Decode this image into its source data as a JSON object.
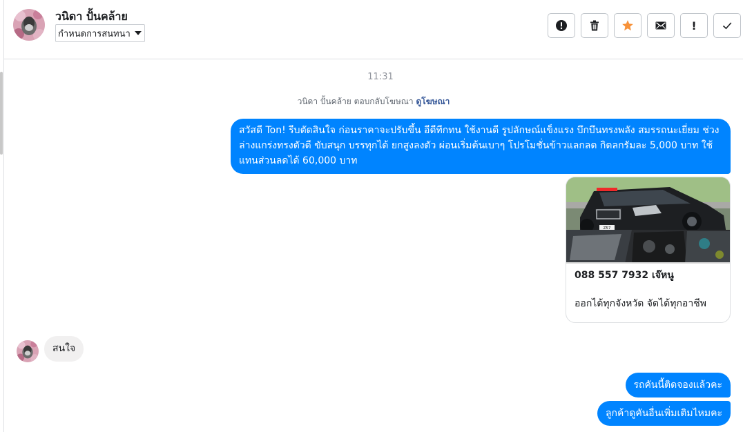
{
  "header": {
    "contact_name": "วนิดา ปั้นคล้าย",
    "assign_label": "กำหนดการสนทนา",
    "toolbar": [
      {
        "id": "spam",
        "icon": "alert-circle-icon"
      },
      {
        "id": "delete",
        "icon": "trash-icon"
      },
      {
        "id": "star",
        "icon": "star-icon"
      },
      {
        "id": "mark-unread",
        "icon": "envelope-icon"
      },
      {
        "id": "follow-up",
        "icon": "exclamation-icon",
        "glyph": "!"
      },
      {
        "id": "done",
        "icon": "check-icon"
      }
    ]
  },
  "conversation": {
    "timestamp": "11:31",
    "reply_note": "วนิดา ปั้นคล้าย ตอบกลับโฆษณา",
    "reply_link": "ดูโฆษณา",
    "messages": [
      {
        "direction": "out",
        "text": "สวัสดี Ton! รีบตัดสินใจ ก่อนราคาจะปรับขึ้น อีดีทีกทน ใช้งานดี รูปลักษณ์แข็งแรง บึกบึนทรงพลัง สมรรถนะเยี่ยม ช่วงล่างแกร่งทรงตัวดี ขับสนุก บรรทุกได้ ยกสูงลงตัว ผ่อนเริ่มต้นเบาๆ โปรโมชั่นข้าวแลกลด กิดลกรัมละ 5,000 บาท ใช้แทนส่วนลดได้ 60,000 บาท"
      },
      {
        "direction": "out",
        "type": "ad-card",
        "title": "088 557 7932 เจ๊หนู",
        "subtitle": "ออกได้ทุกจังหวัด จัดได้ทุกอาชีพ",
        "plate_text": "Z57"
      },
      {
        "direction": "in",
        "text": "สนใจ"
      },
      {
        "direction": "out",
        "text": "รถคันนี้ติดจองแล้วคะ"
      },
      {
        "direction": "out",
        "text": "ลูกค้าดูคันอื่นเพิ่มเติมไหมคะ"
      }
    ]
  },
  "colors": {
    "accent": "#0084ff",
    "star": "#f7923a",
    "incoming_bubble": "#f1f0f0",
    "link": "#365899"
  }
}
